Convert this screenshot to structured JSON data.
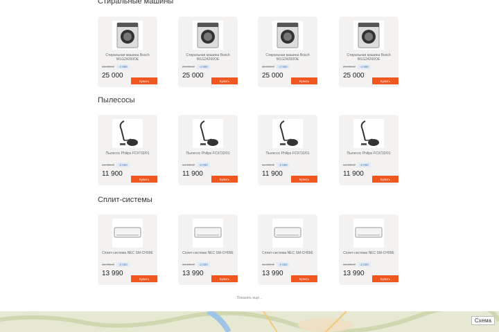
{
  "sections": [
    {
      "title": "Стиральные машины",
      "products": [
        {
          "name": "Стиральная машина Bosch WLG24260OE",
          "old_price": "29 990 ₽",
          "discount": "-4 990",
          "price": "25 000",
          "buy": "Купить"
        },
        {
          "name": "Стиральная машина Bosch WLG24260OE",
          "old_price": "29 990 ₽",
          "discount": "-4 990",
          "price": "25 000",
          "buy": "Купить"
        },
        {
          "name": "Стиральная машина Bosch WLG24260OE",
          "old_price": "29 990 ₽",
          "discount": "-4 990",
          "price": "25 000",
          "buy": "Купить"
        },
        {
          "name": "Стиральная машина Bosch WLG24260OE",
          "old_price": "29 990 ₽",
          "discount": "-4 990",
          "price": "25 000",
          "buy": "Купить"
        }
      ]
    },
    {
      "title": "Пылесосы",
      "products": [
        {
          "name": "Пылесос Philips FC9732/01",
          "old_price": "14 990 ₽",
          "discount": "-3 090",
          "price": "11 900",
          "buy": "Купить"
        },
        {
          "name": "Пылесос Philips FC9732/01",
          "old_price": "14 990 ₽",
          "discount": "-3 090",
          "price": "11 900",
          "buy": "Купить"
        },
        {
          "name": "Пылесос Philips FC9732/01",
          "old_price": "14 990 ₽",
          "discount": "-3 090",
          "price": "11 900",
          "buy": "Купить"
        },
        {
          "name": "Пылесос Philips FC9732/01",
          "old_price": "14 990 ₽",
          "discount": "-3 090",
          "price": "11 900",
          "buy": "Купить"
        }
      ]
    },
    {
      "title": "Сплит-системы",
      "products": [
        {
          "name": "Сплит-система NEC SM-CH09E",
          "old_price": "16 990 ₽",
          "discount": "-3 000",
          "price": "13 990",
          "buy": "Купить"
        },
        {
          "name": "Сплит-система NEC SM-CH09E",
          "old_price": "16 990 ₽",
          "discount": "-3 000",
          "price": "13 990",
          "buy": "Купить"
        },
        {
          "name": "Сплит-система NEC SM-CH09E",
          "old_price": "16 990 ₽",
          "discount": "-3 000",
          "price": "13 990",
          "buy": "Купить"
        },
        {
          "name": "Сплит-система NEC SM-CH09E",
          "old_price": "16 990 ₽",
          "discount": "-3 000",
          "price": "13 990",
          "buy": "Купить"
        }
      ]
    }
  ],
  "show_more": "Показать ещё...",
  "map": {
    "button": "Схема"
  },
  "colors": {
    "accent": "#f0561f",
    "card_bg": "#f3f2f1",
    "discount_bg": "#e3ecf6"
  }
}
